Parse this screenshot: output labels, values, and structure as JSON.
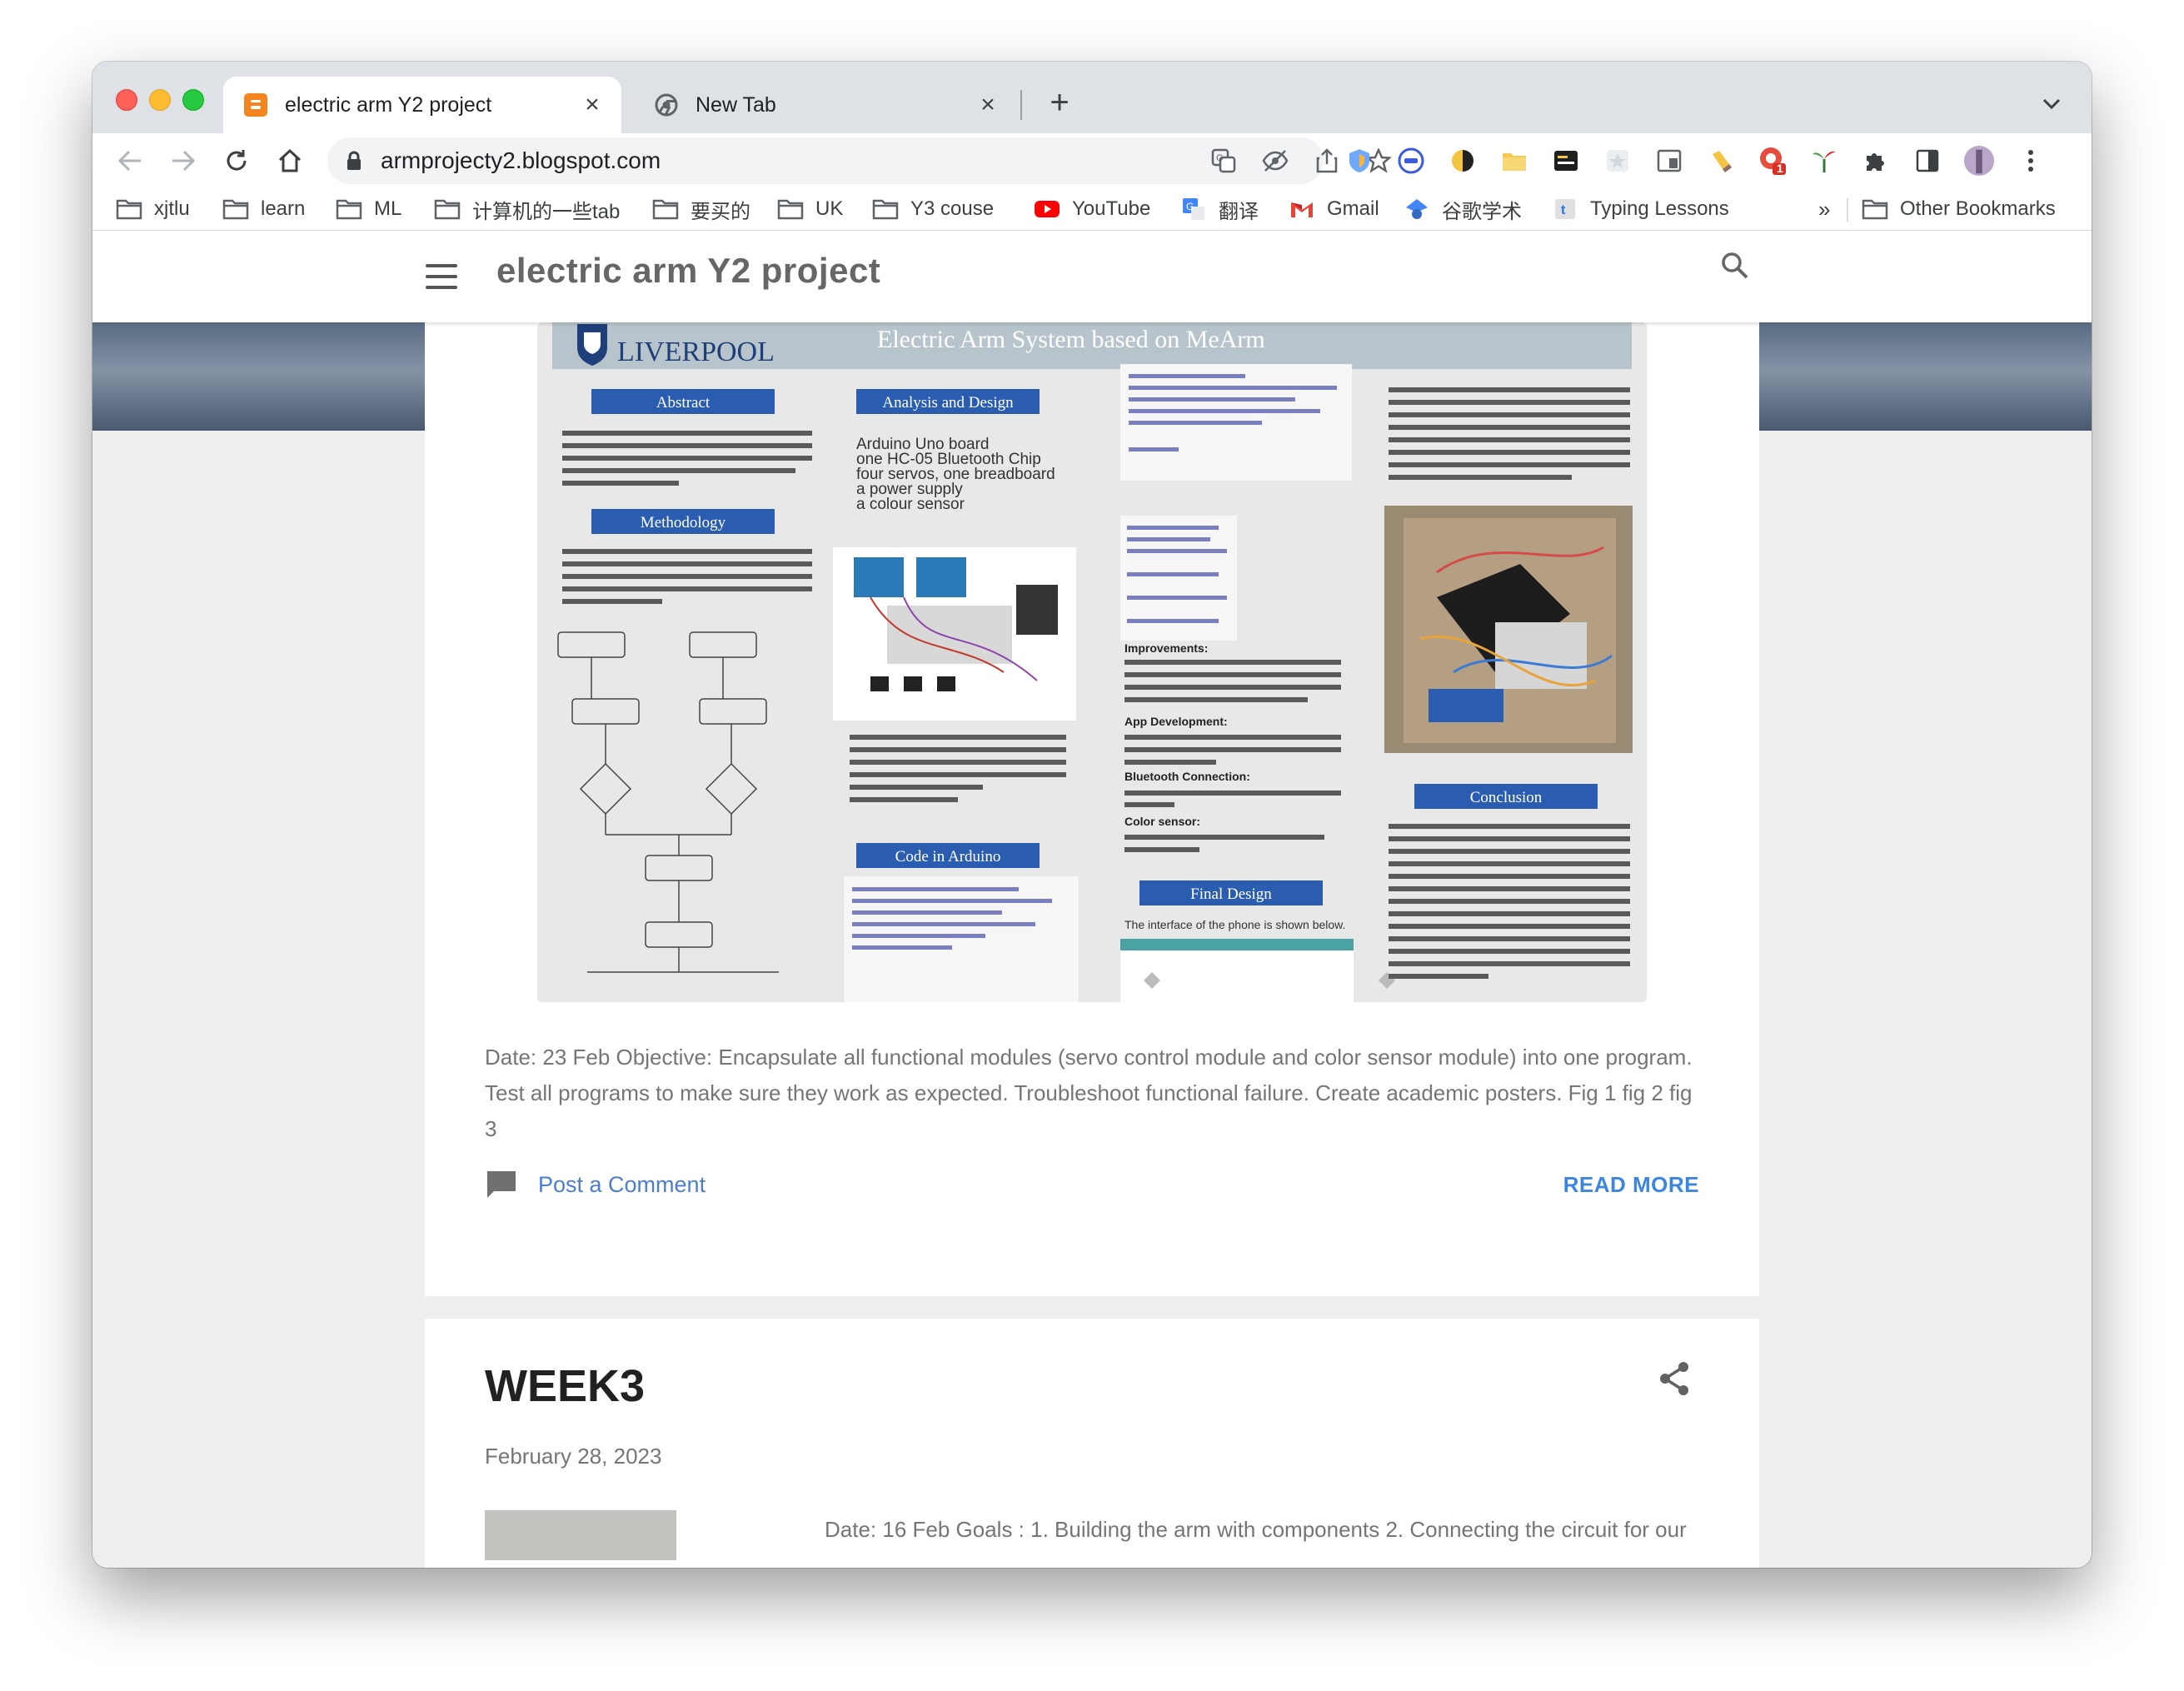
{
  "browser": {
    "tabs": [
      {
        "title": "electric arm Y2 project",
        "icon": "blogger-icon",
        "active": true
      },
      {
        "title": "New Tab",
        "icon": "chrome-icon",
        "active": false
      }
    ],
    "url": "armprojecty2.blogspot.com",
    "bookmarks": [
      {
        "label": "xjtlu",
        "icon": "folder-icon"
      },
      {
        "label": "learn",
        "icon": "folder-icon"
      },
      {
        "label": "ML",
        "icon": "folder-icon"
      },
      {
        "label": "计算机的一些tab",
        "icon": "folder-icon"
      },
      {
        "label": "要买的",
        "icon": "folder-icon"
      },
      {
        "label": "UK",
        "icon": "folder-icon"
      },
      {
        "label": "Y3 couse",
        "icon": "folder-icon"
      },
      {
        "label": "YouTube",
        "icon": "youtube-icon"
      },
      {
        "label": "翻译",
        "icon": "translate-icon"
      },
      {
        "label": "Gmail",
        "icon": "gmail-icon"
      },
      {
        "label": "谷歌学术",
        "icon": "scholar-icon"
      },
      {
        "label": "Typing Lessons",
        "icon": "typing-icon"
      }
    ],
    "overflow_label": "»",
    "other_bookmarks": "Other Bookmarks",
    "extension_badge": "1"
  },
  "blog": {
    "title": "electric arm Y2 project"
  },
  "post1": {
    "poster": {
      "university": "LIVERPOOL",
      "title": "Electric Arm System based on MeArm",
      "sections": [
        "Abstract",
        "Methodology",
        "Analysis and Design",
        "Code in Arduino",
        "Final Design",
        "Conclusion"
      ],
      "abstract_text": "Build a robotic arm that can rotate and carry objects Be able to be controlled by a cellular device via Bluetooth and color sensor.",
      "components": [
        "Arduino Uno board",
        "one HC-05 Bluetooth Chip",
        "four servos, one breadboard",
        "a power supply",
        "a colour sensor"
      ],
      "improvements_heading": "Improvements:",
      "app_heading": "App Development:",
      "bluetooth_heading": "Bluetooth Connection:",
      "color_heading": "Color sensor:",
      "final_design_text": "The interface of the phone is shown below."
    },
    "snippet": "Date: 23 Feb Objective:  Encapsulate all functional modules (servo control module and color sensor module) into one program.  Test all programs to make sure they work as expected.  Troubleshoot functional failure.  Create academic posters. Fig 1 fig 2 fig 3",
    "comment_label": "Post a Comment",
    "read_more": "READ MORE"
  },
  "post2": {
    "title": "WEEK3",
    "date": "February 28, 2023",
    "excerpt": "Date: 16 Feb  Goals : 1. Building the arm with components          2. Connecting the circuit for our"
  },
  "colors": {
    "link": "#4c7ed0",
    "read_more": "#3c86dd",
    "poster_header": "#2a5db0"
  }
}
